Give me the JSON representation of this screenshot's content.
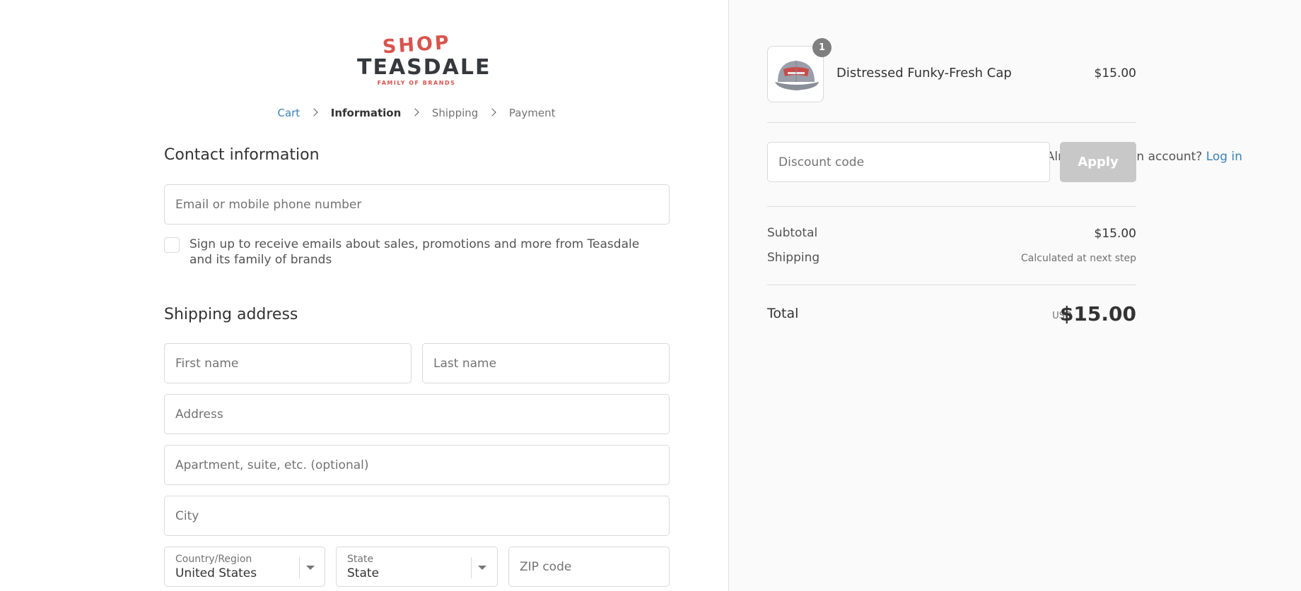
{
  "logo": {
    "shop": "SHOP",
    "brand": "TEASDALE",
    "tagline": "FAMILY OF BRANDS"
  },
  "breadcrumb": {
    "cart": "Cart",
    "information": "Information",
    "shipping": "Shipping",
    "payment": "Payment"
  },
  "contact": {
    "title": "Contact information",
    "account_prompt": "Already have an account?",
    "login_link": "Log in",
    "email_placeholder": "Email or mobile phone number",
    "newsletter_label": "Sign up to receive emails about sales, promotions and more from Teasdale and its family of brands"
  },
  "shipping": {
    "title": "Shipping address",
    "first_name": "First name",
    "last_name": "Last name",
    "address": "Address",
    "apartment": "Apartment, suite, etc. (optional)",
    "city": "City",
    "country_label": "Country/Region",
    "country_value": "United States",
    "state_label": "State",
    "state_value": "State",
    "zip": "ZIP code"
  },
  "order": {
    "item_count": "1",
    "product_name": "Distressed Funky-Fresh Cap",
    "product_price": "$15.00",
    "discount_placeholder": "Discount code",
    "apply_label": "Apply",
    "subtotal_label": "Subtotal",
    "subtotal_value": "$15.00",
    "shipping_label": "Shipping",
    "shipping_value": "Calculated at next step",
    "total_label": "Total",
    "total_currency": "USD",
    "total_value": "$15.00"
  },
  "colors": {
    "link": "#3a82b6",
    "brand_red": "#d9544d",
    "apply_disabled": "#c8c8c8"
  }
}
